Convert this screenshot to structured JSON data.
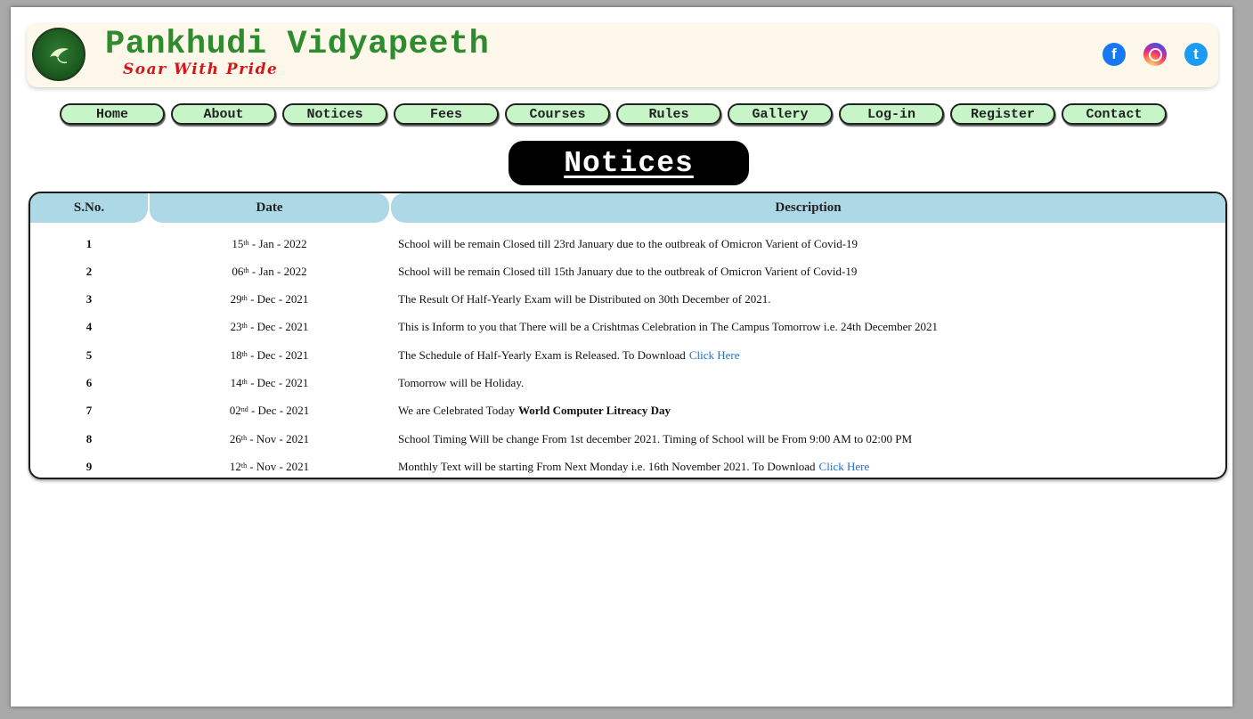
{
  "brand": {
    "name": "Pankhudi Vidyapeeth",
    "tagline": "Soar With Pride",
    "logo_text": "PANKHUDI VIDYAPEETH"
  },
  "social": {
    "facebook_icon": "facebook-icon",
    "instagram_icon": "instagram-icon",
    "twitter_icon": "twitter-icon",
    "facebook_glyph": "f",
    "twitter_glyph": "t"
  },
  "nav": [
    "Home",
    "About",
    "Notices",
    "Fees",
    "Courses",
    "Rules",
    "Gallery",
    "Log-in",
    "Register",
    "Contact"
  ],
  "page_title": "Notices",
  "table": {
    "headers": {
      "sno": "S.No.",
      "date": "Date",
      "description": "Description"
    },
    "rows": [
      {
        "sno": "1",
        "day": "15",
        "suffix": "th",
        "month_year": " - Jan - 2022",
        "desc": "School will be remain Closed till 23rd January due to the outbreak of Omicron Varient of Covid-19",
        "extra": "",
        "extra_type": ""
      },
      {
        "sno": "2",
        "day": "06",
        "suffix": "th",
        "month_year": " - Jan - 2022",
        "desc": "School will be remain Closed till 15th January due to the outbreak of Omicron Varient of Covid-19",
        "extra": "",
        "extra_type": ""
      },
      {
        "sno": "3",
        "day": "29",
        "suffix": "th",
        "month_year": " - Dec - 2021",
        "desc": "The Result Of Half-Yearly Exam will be Distributed on 30th December of 2021.",
        "extra": "",
        "extra_type": ""
      },
      {
        "sno": "4",
        "day": "23",
        "suffix": "th",
        "month_year": " - Dec - 2021",
        "desc": "This is Inform to you that There will be a Crishtmas Celebration in The Campus Tomorrow i.e. 24th December 2021",
        "extra": "",
        "extra_type": ""
      },
      {
        "sno": "5",
        "day": "18",
        "suffix": "th",
        "month_year": " - Dec - 2021",
        "desc": "The Schedule of Half-Yearly Exam is Released. To Download",
        "extra": "Click Here",
        "extra_type": "link"
      },
      {
        "sno": "6",
        "day": "14",
        "suffix": "th",
        "month_year": " - Dec - 2021",
        "desc": "Tomorrow will be Holiday.",
        "extra": "",
        "extra_type": ""
      },
      {
        "sno": "7",
        "day": "02",
        "suffix": "nd",
        "month_year": " - Dec - 2021",
        "desc": "We are Celebrated Today",
        "extra": "World Computer Litreacy Day",
        "extra_type": "bold"
      },
      {
        "sno": "8",
        "day": "26",
        "suffix": "th",
        "month_year": " - Nov - 2021",
        "desc": "School Timing Will be change From 1st december 2021. Timing of School will be From 9:00 AM to 02:00 PM",
        "extra": "",
        "extra_type": ""
      },
      {
        "sno": "9",
        "day": "12",
        "suffix": "th",
        "month_year": " - Nov - 2021",
        "desc": "Monthly Text will be starting From Next Monday i.e. 16th November 2021. To Download",
        "extra": "Click Here",
        "extra_type": "link"
      }
    ]
  },
  "colors": {
    "brand_green": "#2e8b2e",
    "tagline_red": "#d6151b",
    "nav_bg": "#c8f5c8",
    "table_header_bg": "#add8e6",
    "link_blue": "#1e6fd0"
  }
}
